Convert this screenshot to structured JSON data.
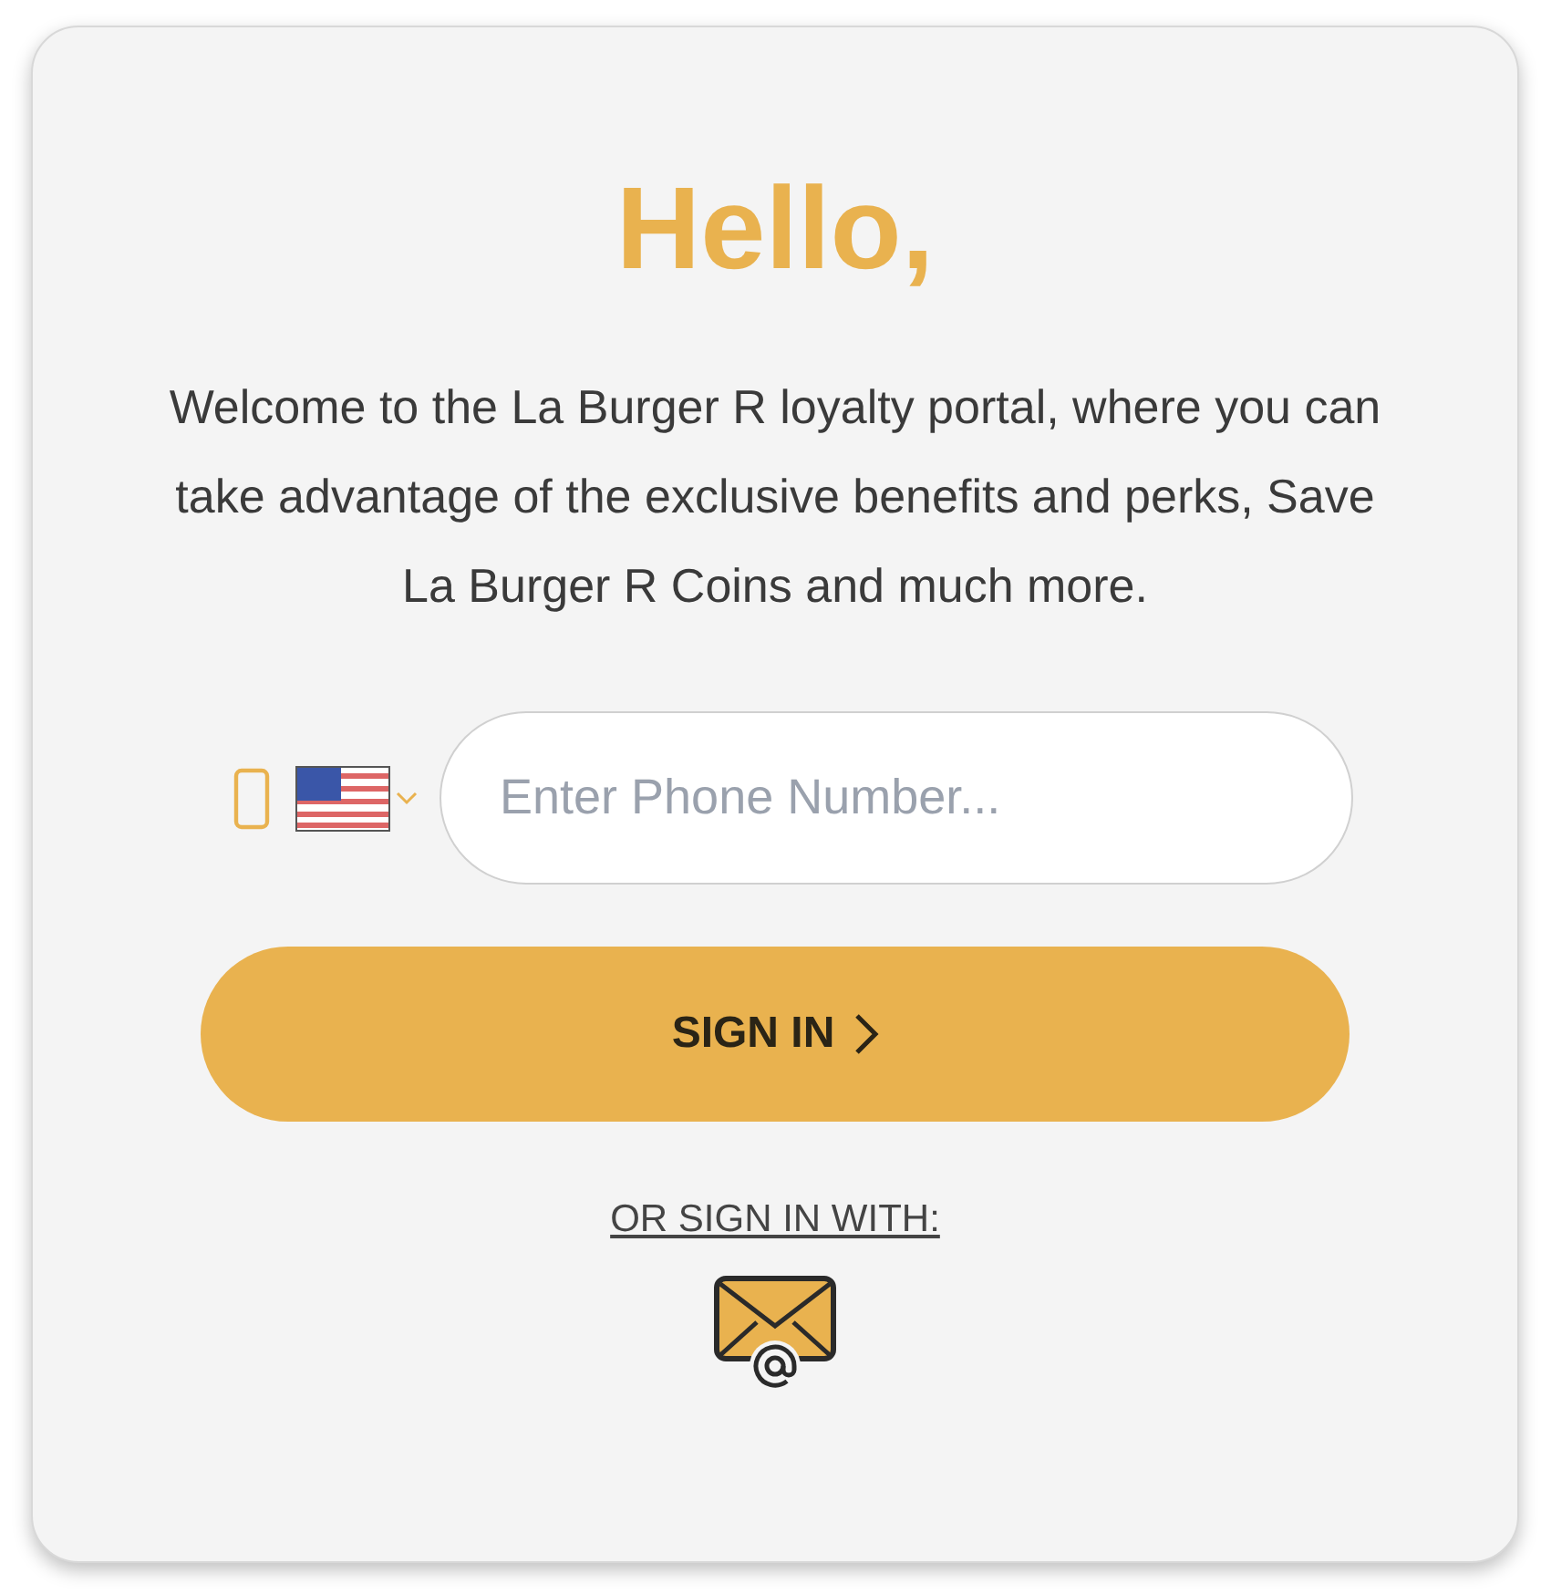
{
  "title": "Hello,",
  "intro": "Welcome to the La Burger R loyalty portal, where you can take advantage of the exclusive benefits and perks, Save La Burger R Coins and much more.",
  "phone": {
    "placeholder": "Enter Phone Number..."
  },
  "sign_in_button": {
    "label": "SIGN IN"
  },
  "alt_sign_in_link": "OR SIGN IN WITH:"
}
